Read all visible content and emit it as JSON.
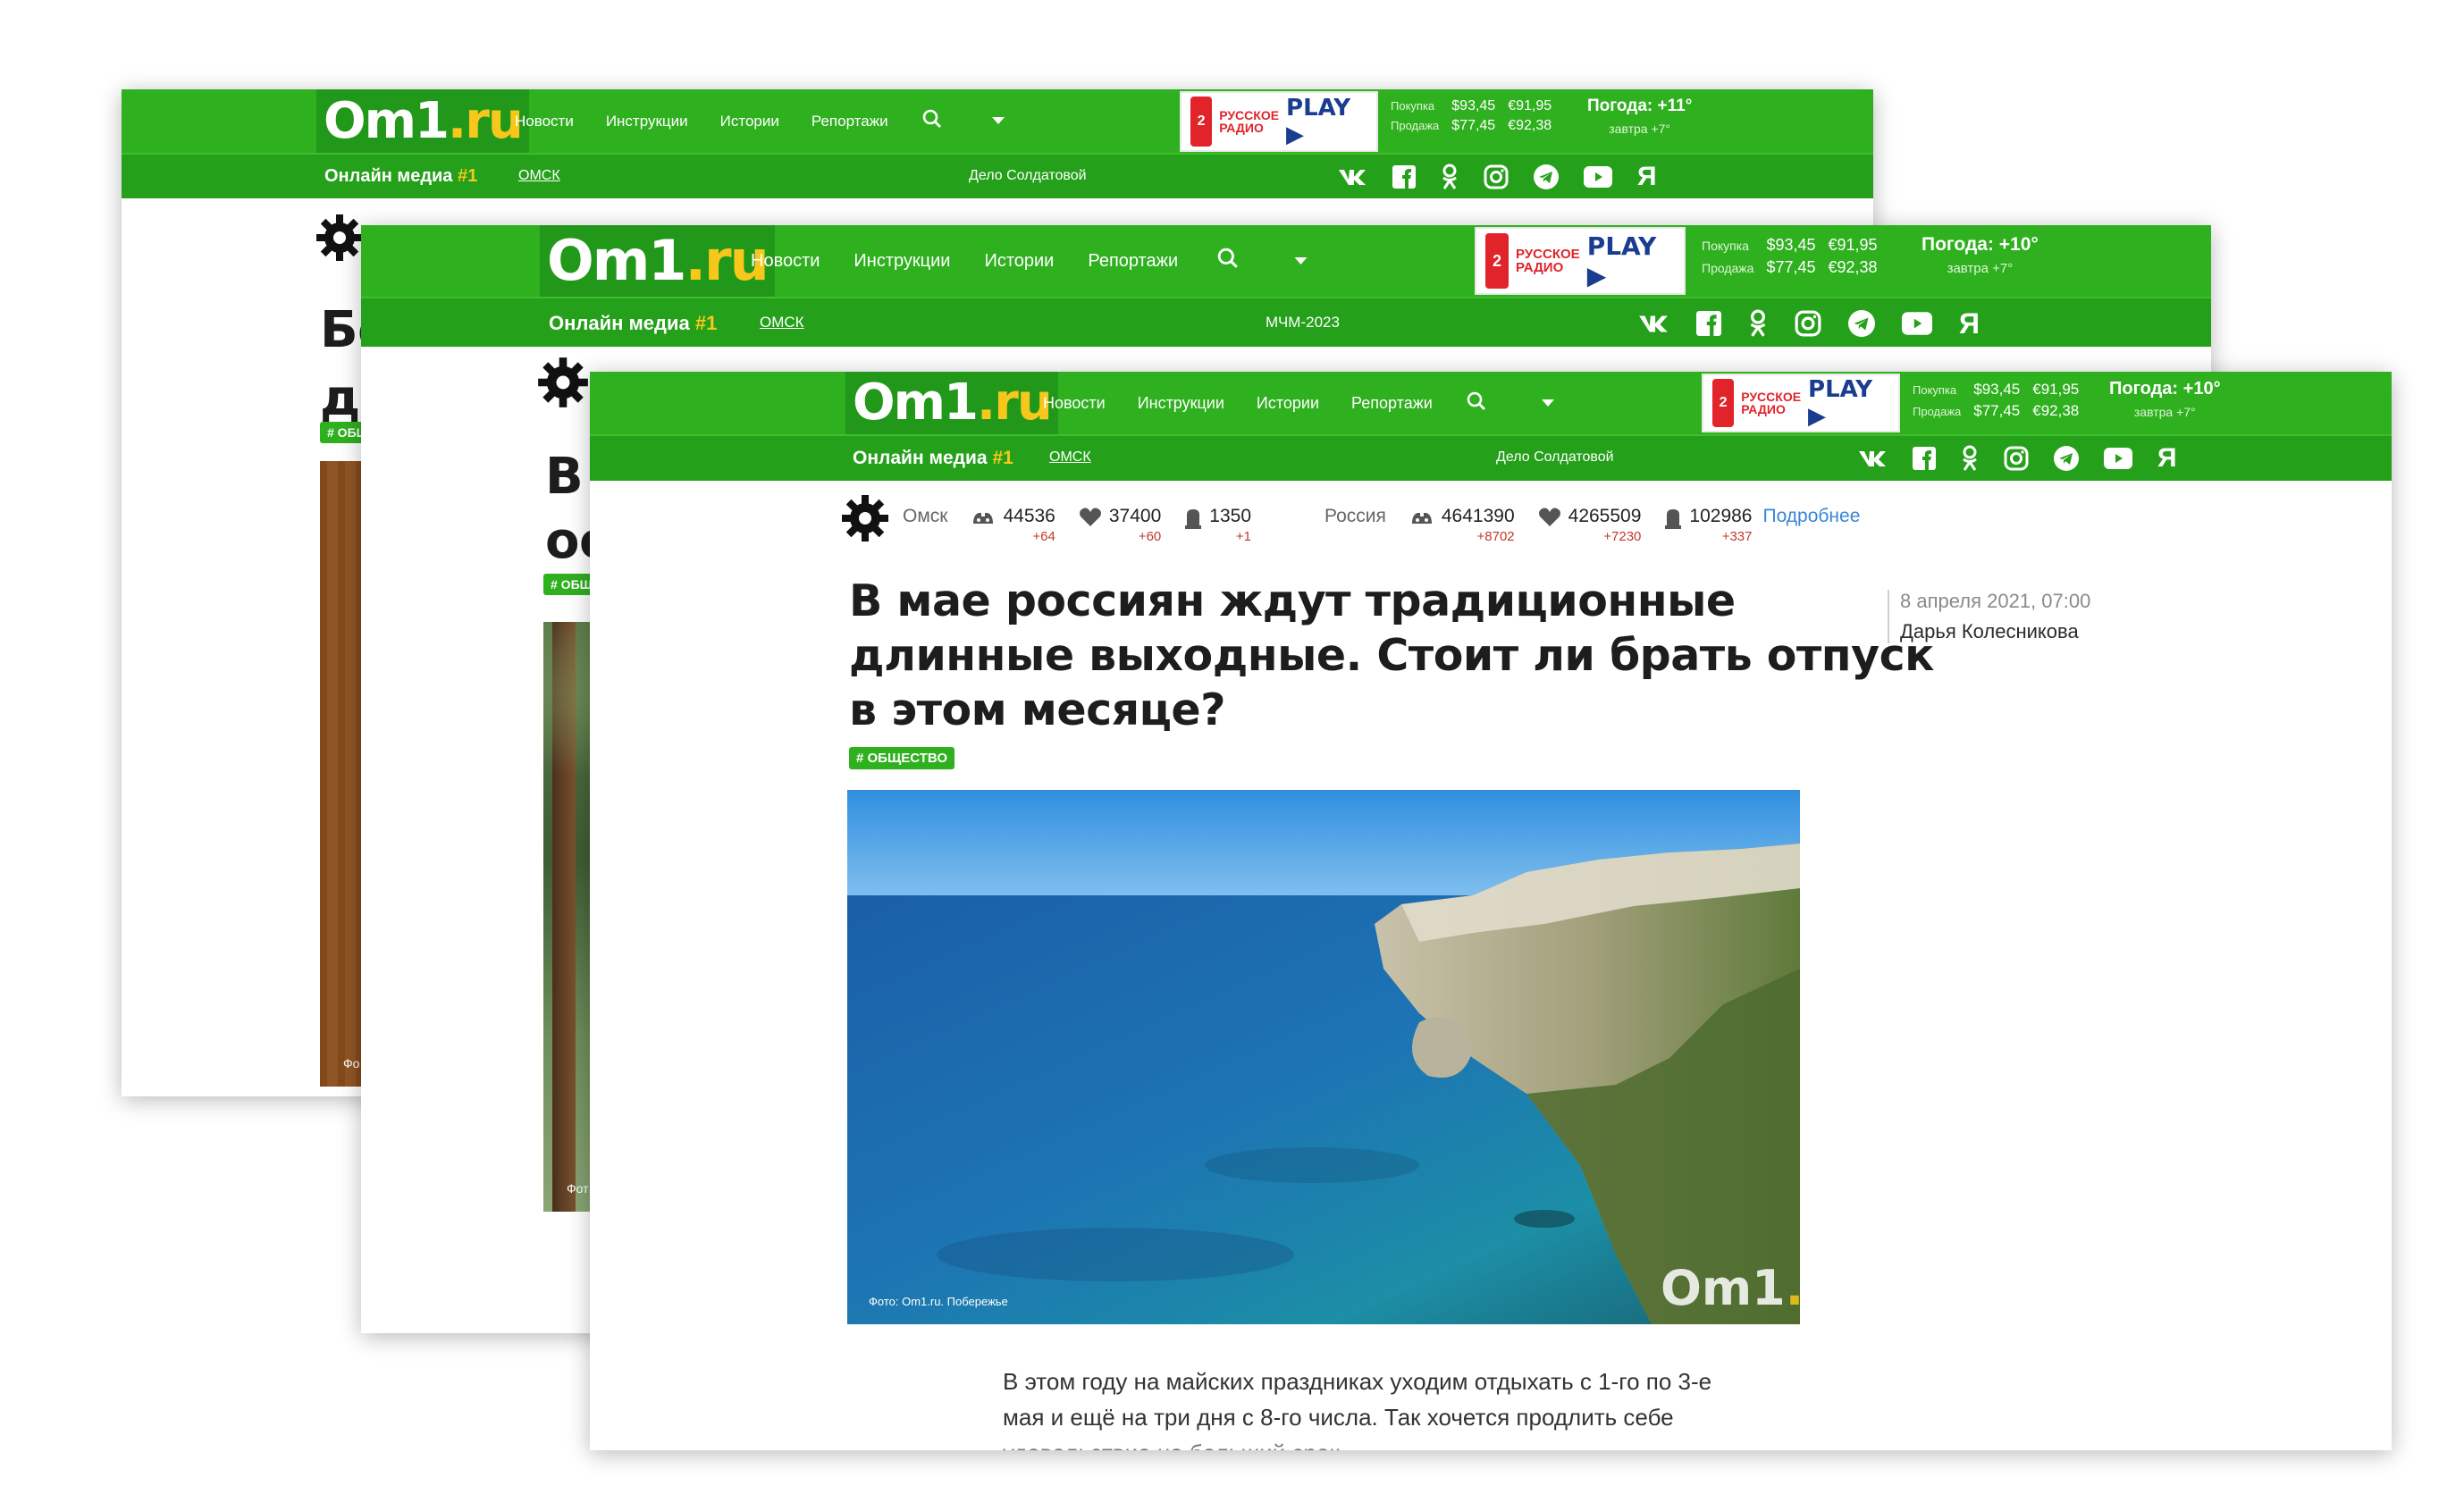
{
  "site": {
    "logo_main": "Om1",
    "logo_suffix": ".ru",
    "tagline": "Онлайн медиа",
    "tagline_hash": "#1",
    "nav": [
      "Новости",
      "Инструкции",
      "Истории",
      "Репортажи"
    ],
    "radio_line1": "РУССКОЕ",
    "radio_line2": "РАДИО",
    "radio_play": "PLAY ▶",
    "rates": {
      "buy_label": "Покупка",
      "sell_label": "Продажа",
      "usd_buy": "$93,45",
      "eur_buy": "€91,95",
      "usd_sell": "$77,45",
      "eur_sell": "€92,38"
    },
    "city": "ОМСК"
  },
  "pages": [
    {
      "weather_today": "Погода: +11°",
      "weather_tomorrow": "завтра +7°",
      "topic": "Дело Солдатовой",
      "title_fragment_1": "Бо",
      "title_fragment_2": "ди",
      "tag_fragment": "# ОБЩ",
      "photo_credit_fragment": "Фо"
    },
    {
      "weather_today": "Погода: +10°",
      "weather_tomorrow": "завтра +7°",
      "topic": "МЧМ-2023",
      "title_fragment_1": "В",
      "title_fragment_2": "ос",
      "tag_fragment": "# ОБЩ",
      "photo_credit_fragment": "Фот"
    },
    {
      "weather_today": "Погода: +10°",
      "weather_tomorrow": "завтра +7°",
      "topic": "Дело Солдатовой",
      "stats": {
        "city_label": "Омск",
        "city_sick": "44536",
        "city_sick_delta": "+64",
        "city_recovered": "37400",
        "city_recovered_delta": "+60",
        "city_deaths": "1350",
        "city_deaths_delta": "+1",
        "country_label": "Россия",
        "country_sick": "4641390",
        "country_sick_delta": "+8702",
        "country_recovered": "4265509",
        "country_recovered_delta": "+7230",
        "country_deaths": "102986",
        "country_deaths_delta": "+337",
        "more": "Подробнее"
      },
      "article": {
        "title_line1": "В мае россиян ждут традиционные",
        "title_line2": "длинные выходные. Стоит ли брать отпуск",
        "title_line3": "в этом месяце?",
        "tag": "# ОБЩЕСТВО",
        "date": "8 апреля 2021, 07:00",
        "author": "Дарья Колесникова",
        "photo_credit": "Фото: Om1.ru. Побережье",
        "lead_line1": "В этом году на майских праздниках уходим отдыхать с 1-го по 3-е",
        "lead_line2": "мая и ещё на три дня с 8-го числа. Так хочется продлить себе",
        "lead_line3": "удовольствие на больший срок"
      }
    }
  ],
  "icons": [
    "gear-icon",
    "search-icon",
    "chevron-down-icon",
    "vk-icon",
    "facebook-icon",
    "odnoklassniki-icon",
    "instagram-icon",
    "telegram-icon",
    "youtube-icon",
    "yandex-icon",
    "virus-icon",
    "heart-icon",
    "grave-icon"
  ],
  "colors": {
    "brand_green": "#2fb01f",
    "logo_yellow": "#f7c81b",
    "radio_red": "#e0242a",
    "link_blue": "#3a86d4",
    "delta_red": "#c0392b"
  }
}
